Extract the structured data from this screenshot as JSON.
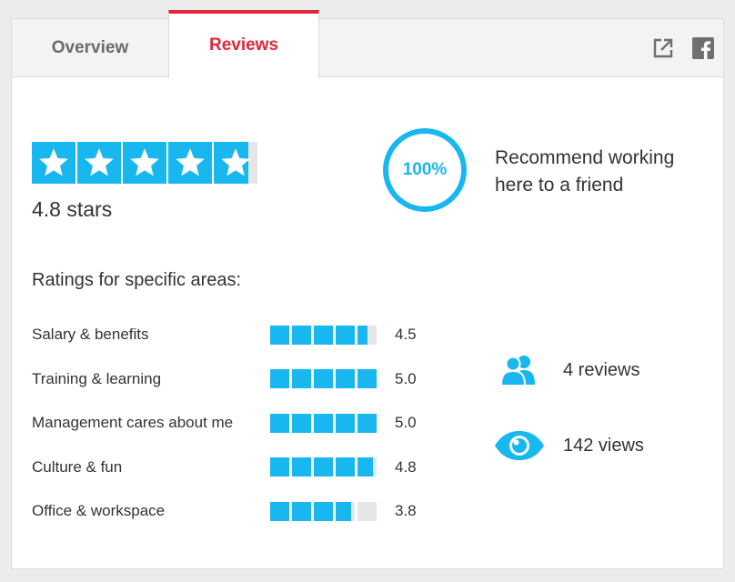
{
  "tabs": {
    "overview": "Overview",
    "reviews": "Reviews"
  },
  "colors": {
    "accent": "#19b7f0",
    "active_tab": "#e0263a"
  },
  "header_icons": [
    "external-link-icon",
    "facebook-icon"
  ],
  "overall": {
    "rating": 4.8,
    "label": "4.8 stars"
  },
  "recommend": {
    "percent": "100%",
    "text": "Recommend working here to a friend"
  },
  "areas": {
    "title": "Ratings for specific areas:",
    "items": [
      {
        "label": "Salary & benefits",
        "value": "4.5"
      },
      {
        "label": "Training & learning",
        "value": "5.0"
      },
      {
        "label": "Management cares about me",
        "value": "5.0"
      },
      {
        "label": "Culture & fun",
        "value": "4.8"
      },
      {
        "label": "Office & workspace",
        "value": "3.8"
      }
    ]
  },
  "stats": {
    "reviews": "4 reviews",
    "views": "142 views",
    "reviews_icon": "users-icon",
    "views_icon": "eye-icon"
  }
}
